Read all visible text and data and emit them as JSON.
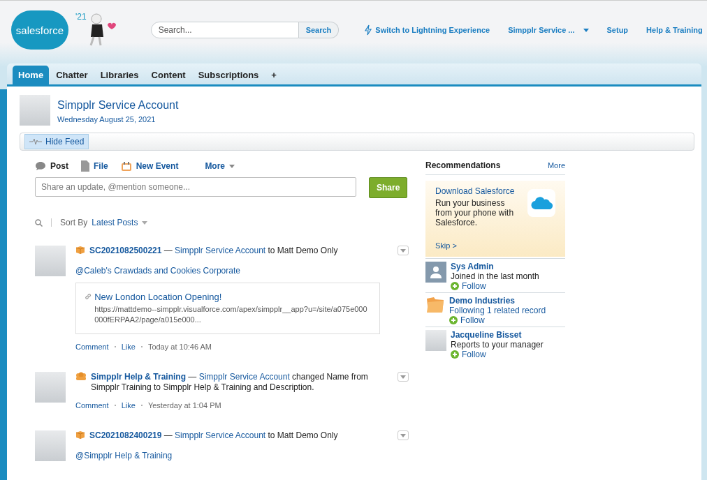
{
  "header": {
    "logo": "salesforce",
    "year": "'21",
    "search": {
      "placeholder": "Search...",
      "button": "Search"
    },
    "nav": [
      {
        "label": "Switch to Lightning Experience",
        "kind": "lightning"
      },
      {
        "label": "Simpplr Service ...",
        "kind": "menu"
      },
      {
        "label": "Setup",
        "kind": "plain"
      },
      {
        "label": "Help & Training",
        "kind": "plain"
      }
    ]
  },
  "tabs": [
    {
      "label": "Home",
      "selected": true
    },
    {
      "label": "Chatter",
      "selected": false
    },
    {
      "label": "Libraries",
      "selected": false
    },
    {
      "label": "Content",
      "selected": false
    },
    {
      "label": "Subscriptions",
      "selected": false
    }
  ],
  "add_tab": "+",
  "profile": {
    "name": "Simpplr Service Account",
    "date": "Wednesday August 25, 2021"
  },
  "hide_feed": "Hide Feed",
  "publisher": {
    "actions": [
      {
        "label": "Post",
        "kind": "post",
        "selected": true
      },
      {
        "label": "File",
        "kind": "file",
        "selected": false
      },
      {
        "label": "New Event",
        "kind": "event",
        "selected": false
      },
      {
        "label": "More",
        "kind": "more",
        "selected": false
      }
    ],
    "placeholder": "Share an update, @mention someone...",
    "share": "Share"
  },
  "sort": {
    "label": "Sort By",
    "value": "Latest Posts"
  },
  "feed": [
    {
      "kind": "record",
      "parts": [
        {
          "text": "SC2021082500221",
          "kind": "record"
        },
        {
          "text": " — ",
          "kind": "plain"
        },
        {
          "text": "Simpplr Service Account",
          "kind": "link"
        },
        {
          "text": " to Matt Demo Only",
          "kind": "plain"
        }
      ],
      "mention": "@Caleb's Crawdads and Cookies Corporate",
      "link_card": {
        "title": "New London Location Opening!",
        "url": "https://mattdemo--simpplr.visualforce.com/apex/simpplr__app?u=/site/a075e000000fERPAA2/page/a015e000..."
      },
      "actions": [
        "Comment",
        "Like"
      ],
      "time": "Today at 10:46 AM"
    },
    {
      "kind": "group",
      "parts": [
        {
          "text": "Simpplr Help & Training",
          "kind": "record"
        },
        {
          "text": " — ",
          "kind": "plain"
        },
        {
          "text": "Simpplr Service Account",
          "kind": "link"
        },
        {
          "text": " changed Name from Simpplr Training to Simpplr Help & Training and Description.",
          "kind": "plain"
        }
      ],
      "actions": [
        "Comment",
        "Like"
      ],
      "time": "Yesterday at 1:04 PM"
    },
    {
      "kind": "record",
      "parts": [
        {
          "text": "SC2021082400219",
          "kind": "record"
        },
        {
          "text": " — ",
          "kind": "plain"
        },
        {
          "text": "Simpplr Service Account",
          "kind": "link"
        },
        {
          "text": " to Matt Demo Only",
          "kind": "plain"
        }
      ],
      "mention": "@Simpplr Help & Training"
    }
  ],
  "recommendations": {
    "title": "Recommendations",
    "more": "More",
    "promo": {
      "title": "Download Salesforce",
      "body": "Run your business from your phone with Salesforce.",
      "skip": "Skip >"
    },
    "items": [
      {
        "name": "Sys Admin",
        "detail": "Joined in the last month",
        "detail_link": false,
        "kind": "user",
        "follow": "Follow"
      },
      {
        "name": "Demo Industries",
        "detail": "Following 1 related record",
        "detail_link": true,
        "kind": "record",
        "follow": "Follow"
      },
      {
        "name": "Jacqueline Bisset",
        "detail": "Reports to your manager",
        "detail_link": false,
        "kind": "person",
        "follow": "Follow"
      }
    ]
  }
}
